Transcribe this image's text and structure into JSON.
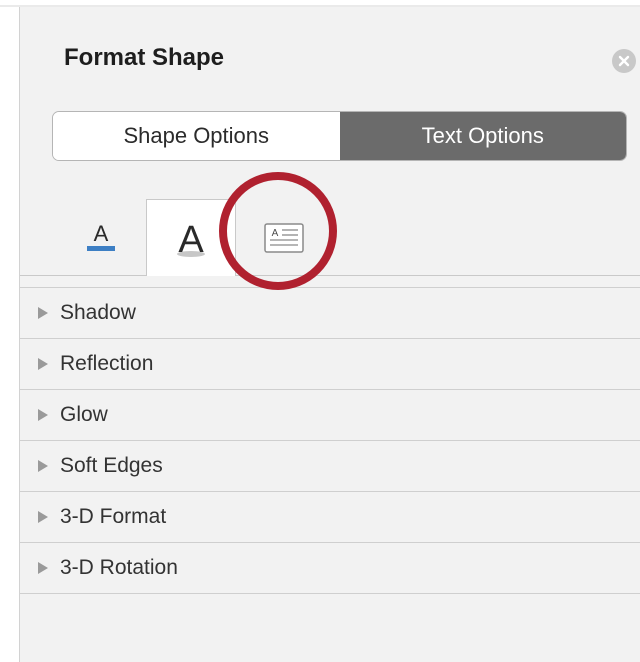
{
  "pane": {
    "title": "Format Shape"
  },
  "segments": {
    "shape_options": "Shape Options",
    "text_options": "Text Options",
    "selected": "Text Options"
  },
  "tabs": {
    "items": [
      {
        "icon": "text-fill-outline-icon",
        "label": "A"
      },
      {
        "icon": "text-effects-icon",
        "label": "A"
      },
      {
        "icon": "textbox-icon",
        "label": "A"
      }
    ],
    "selected_index": 1
  },
  "sections": [
    {
      "label": "Shadow"
    },
    {
      "label": "Reflection"
    },
    {
      "label": "Glow"
    },
    {
      "label": "Soft Edges"
    },
    {
      "label": "3-D Format"
    },
    {
      "label": "3-D Rotation"
    }
  ],
  "colors": {
    "highlight_ring": "#b0212f",
    "active_segment": "#6b6b6b",
    "fill_underline": "#3d7fc4"
  }
}
